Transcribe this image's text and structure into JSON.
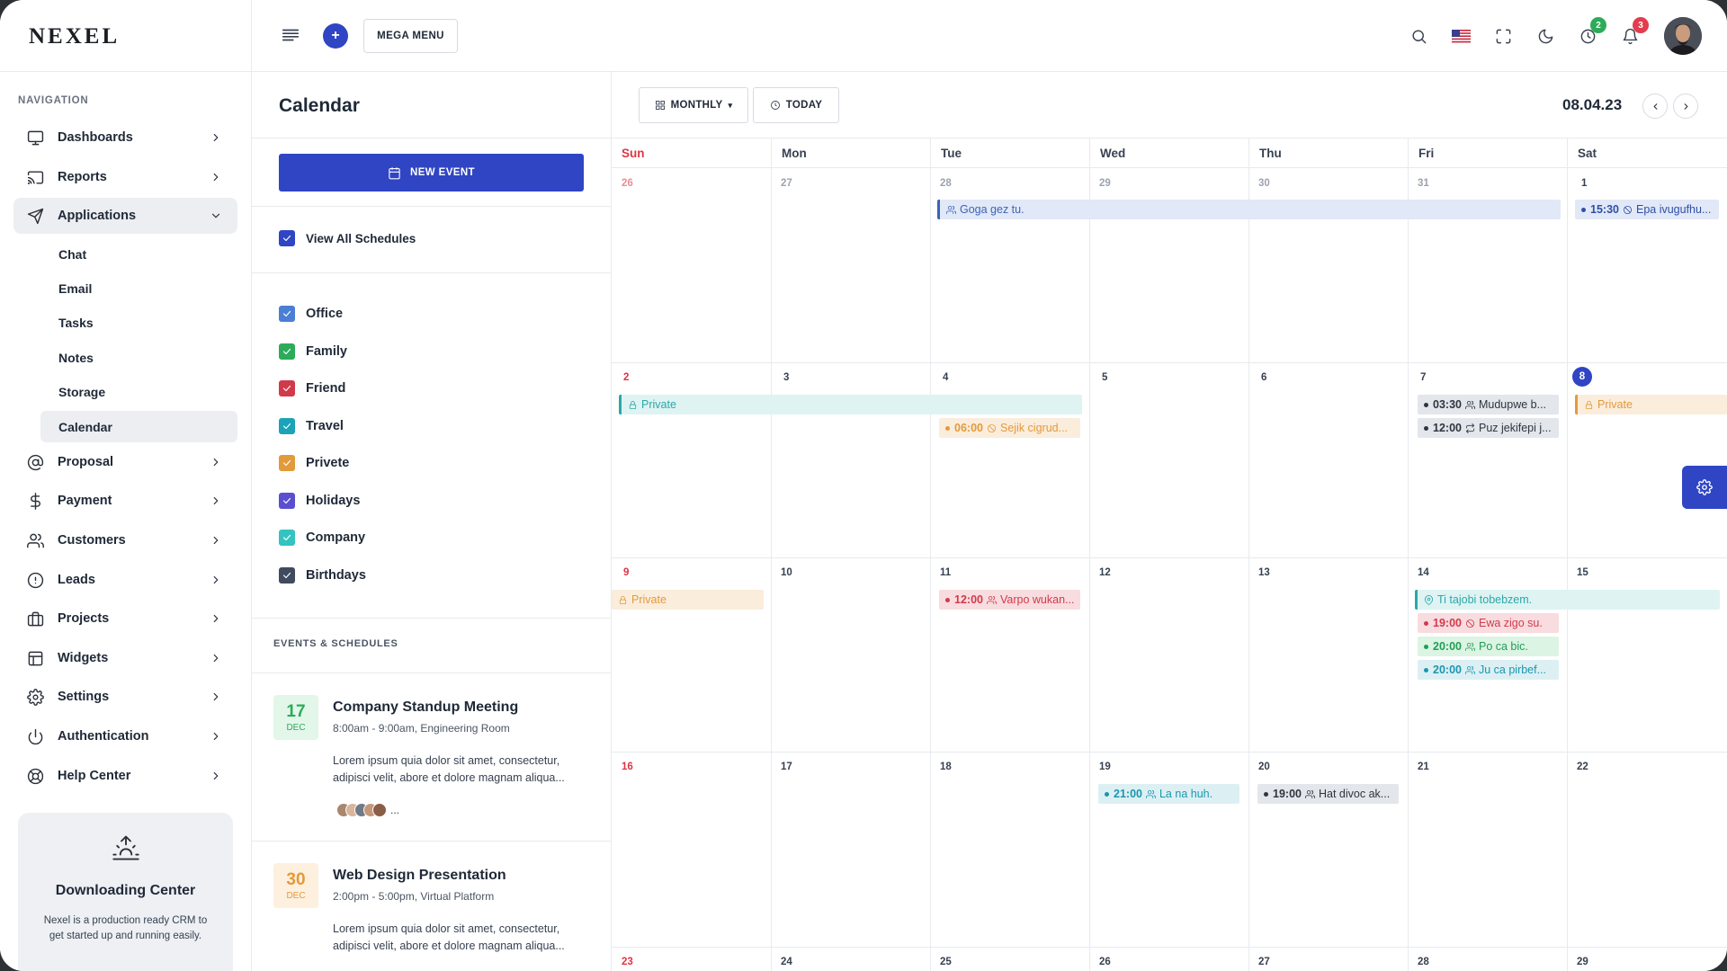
{
  "brand": {
    "name": "NEXEL"
  },
  "topbar": {
    "mega_menu": "MEGA MENU",
    "add_label": "+",
    "badges": {
      "activity": "2",
      "notifications": "3"
    }
  },
  "sidebar": {
    "heading": "NAVIGATION",
    "items": [
      {
        "label": "Dashboards",
        "icon": "monitor-icon"
      },
      {
        "label": "Reports",
        "icon": "cast-icon"
      },
      {
        "label": "Applications",
        "icon": "send-icon"
      },
      {
        "label": "Proposal",
        "icon": "at-sign-icon"
      },
      {
        "label": "Payment",
        "icon": "dollar-icon"
      },
      {
        "label": "Customers",
        "icon": "users-icon"
      },
      {
        "label": "Leads",
        "icon": "alert-circle-icon"
      },
      {
        "label": "Projects",
        "icon": "briefcase-icon"
      },
      {
        "label": "Widgets",
        "icon": "layout-icon"
      },
      {
        "label": "Settings",
        "icon": "gear-icon"
      },
      {
        "label": "Authentication",
        "icon": "power-icon"
      },
      {
        "label": "Help Center",
        "icon": "life-buoy-icon"
      }
    ],
    "sub_items": [
      "Chat",
      "Email",
      "Tasks",
      "Notes",
      "Storage",
      "Calendar"
    ],
    "download_card": {
      "title": "Downloading Center",
      "text": "Nexel is a production ready CRM to get started up and running easily."
    }
  },
  "left_panel": {
    "title": "Calendar",
    "new_event": "NEW EVENT",
    "view_all": "View All Schedules",
    "schedules": [
      {
        "label": "Office",
        "color": "#4a7fd4"
      },
      {
        "label": "Family",
        "color": "#2dab5a"
      },
      {
        "label": "Friend",
        "color": "#d13a4a"
      },
      {
        "label": "Travel",
        "color": "#1ba3b8"
      },
      {
        "label": "Privete",
        "color": "#e39a3b"
      },
      {
        "label": "Holidays",
        "color": "#5a4fcf"
      },
      {
        "label": "Company",
        "color": "#34c3c0"
      },
      {
        "label": "Birthdays",
        "color": "#3f4b5e"
      }
    ],
    "events_heading": "EVENTS & SCHEDULES",
    "events": [
      {
        "day": "17",
        "month": "DEC",
        "title": "Company Standup Meeting",
        "meta": "8:00am - 9:00am, Engineering Room",
        "desc": "Lorem ipsum quia dolor sit amet, consectetur, adipisci velit, abore et dolore magnam aliqua...",
        "more": "..."
      },
      {
        "day": "30",
        "month": "DEC",
        "title": "Web Design Presentation",
        "meta": "2:00pm - 5:00pm, Virtual Platform",
        "desc": "Lorem ipsum quia dolor sit amet, consectetur, adipisci velit, abore et dolore magnam aliqua..."
      }
    ]
  },
  "calendar": {
    "view_mode": "MONTHLY",
    "today_btn": "TODAY",
    "current_date": "08.04.23",
    "weekdays": [
      "Sun",
      "Mon",
      "Tue",
      "Wed",
      "Thu",
      "Fri",
      "Sat"
    ],
    "weeks": [
      [
        "26",
        "27",
        "28",
        "29",
        "30",
        "31",
        "1"
      ],
      [
        "2",
        "3",
        "4",
        "5",
        "6",
        "7",
        "8"
      ],
      [
        "9",
        "10",
        "11",
        "12",
        "13",
        "14",
        "15"
      ],
      [
        "16",
        "17",
        "18",
        "19",
        "20",
        "21",
        "22"
      ],
      [
        "23",
        "24",
        "25",
        "26",
        "27",
        "28",
        "29"
      ]
    ],
    "today": "8",
    "events": {
      "goga": {
        "text": "Goga gez tu."
      },
      "epa": {
        "time": "15:30",
        "text": "Epa ivugufhu..."
      },
      "private1": {
        "text": "Private"
      },
      "sejik": {
        "time": "06:00",
        "text": "Sejik cigrud..."
      },
      "mudupwe": {
        "time": "03:30",
        "text": "Mudupwe b..."
      },
      "puz": {
        "time": "12:00",
        "text": "Puz jekifepi j..."
      },
      "private2": {
        "text": "Private"
      },
      "private3": {
        "text": "Private"
      },
      "varpo": {
        "time": "12:00",
        "text": "Varpo wukan..."
      },
      "tajobi": {
        "text": "Ti tajobi tobebzem."
      },
      "ewa": {
        "time": "19:00",
        "text": "Ewa zigo su."
      },
      "poca": {
        "time": "20:00",
        "text": "Po ca bic."
      },
      "ju": {
        "time": "20:00",
        "text": "Ju ca pirbef..."
      },
      "lana": {
        "time": "21:00",
        "text": "La na huh."
      },
      "hat": {
        "time": "19:00",
        "text": "Hat divoc ak..."
      }
    }
  }
}
